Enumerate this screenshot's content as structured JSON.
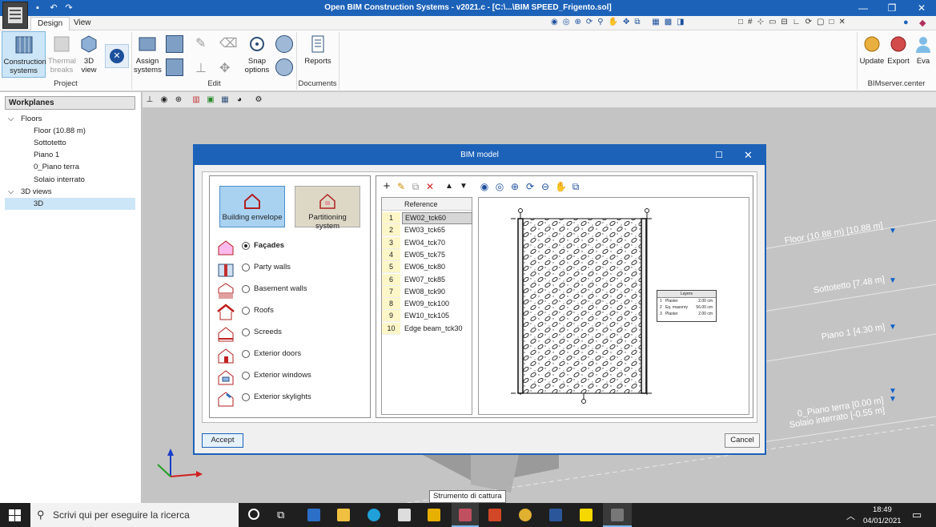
{
  "titlebar": {
    "title": "Open BIM Construction Systems - v2021.c - [C:\\...\\BIM SPEED_Frigento.sol]"
  },
  "tabs": [
    {
      "label": "Design"
    },
    {
      "label": "View"
    }
  ],
  "ribbon": {
    "buttons": {
      "construction_systems": "Construction systems",
      "thermal_breaks": "Thermal breaks",
      "view3d": "3D view",
      "assign_systems": "Assign systems",
      "snap_options": "Snap options",
      "reports": "Reports",
      "update": "Update",
      "export": "Export",
      "eva": "Eva"
    },
    "groups": {
      "project": "Project",
      "edit": "Edit",
      "documents": "Documents",
      "bimserver": "BIMserver.center"
    }
  },
  "workplanes": {
    "header": "Workplanes",
    "floors_label": "Floors",
    "floors": [
      "Floor (10.88 m)",
      "Sottotetto",
      "Piano 1",
      "0_Piano terra",
      "Solaio interrato"
    ],
    "views_label": "3D views",
    "views": [
      "3D"
    ]
  },
  "levels": [
    {
      "label": "Floor (10.88 m) [10.88 m]"
    },
    {
      "label": "Sottotetto [7.48 m]"
    },
    {
      "label": "Piano 1 [4.30 m]"
    },
    {
      "label": "0_Piano terra [0.00 m]"
    },
    {
      "label": "Solaio interrato [-0.55 m]"
    }
  ],
  "dialog": {
    "title": "BIM model",
    "big_buttons": {
      "building_envelope": "Building envelope",
      "partitioning_system": "Partitioning system"
    },
    "options": [
      {
        "label": "Façades",
        "selected": true
      },
      {
        "label": "Party walls",
        "selected": false
      },
      {
        "label": "Basement walls",
        "selected": false
      },
      {
        "label": "Roofs",
        "selected": false
      },
      {
        "label": "Screeds",
        "selected": false
      },
      {
        "label": "Exterior doors",
        "selected": false
      },
      {
        "label": "Exterior windows",
        "selected": false
      },
      {
        "label": "Exterior skylights",
        "selected": false
      }
    ],
    "table_header": "Reference",
    "rows": [
      {
        "n": "1",
        "ref": "EW02_tck60"
      },
      {
        "n": "2",
        "ref": "EW03_tck65"
      },
      {
        "n": "3",
        "ref": "EW04_tck70"
      },
      {
        "n": "4",
        "ref": "EW05_tck75"
      },
      {
        "n": "5",
        "ref": "EW06_tck80"
      },
      {
        "n": "6",
        "ref": "EW07_tck85"
      },
      {
        "n": "7",
        "ref": "EW08_tck90"
      },
      {
        "n": "8",
        "ref": "EW09_tck100"
      },
      {
        "n": "9",
        "ref": "EW10_tck105"
      },
      {
        "n": "10",
        "ref": "Edge beam_tck30"
      }
    ],
    "legend": {
      "title": "Layers",
      "rows": [
        {
          "n": "1",
          "name": "Plaster",
          "thk": "2.00 cm"
        },
        {
          "n": "2",
          "name": "Eq. masonry",
          "thk": "56.00 cm"
        },
        {
          "n": "3",
          "name": "Plaster",
          "thk": "2.00 cm"
        }
      ]
    },
    "accept": "Accept",
    "cancel": "Cancel"
  },
  "taskbar": {
    "search_placeholder": "Scrivi qui per eseguire la ricerca",
    "time": "18:49",
    "date": "04/01/2021",
    "tooltip": "Strumento di cattura"
  }
}
